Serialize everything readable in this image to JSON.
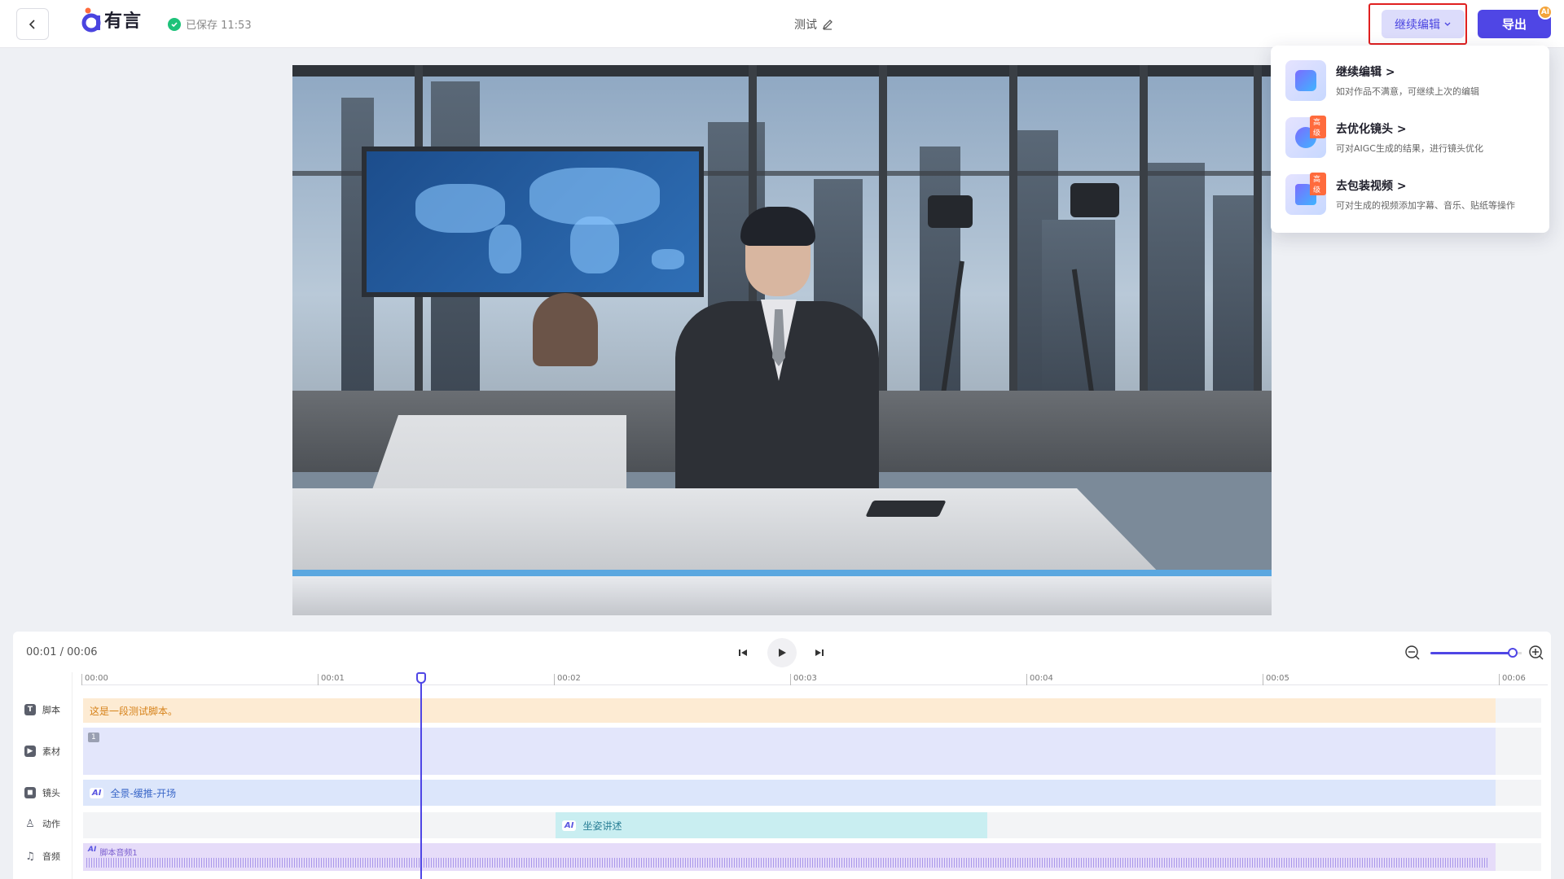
{
  "header": {
    "logo_text": "有言",
    "save_status": "已保存 11:53",
    "doc_title": "测试",
    "continue_label": "继续编辑",
    "export_label": "导出",
    "ai_badge": "AI"
  },
  "dropdown": {
    "items": [
      {
        "title": "继续编辑 >",
        "desc": "如对作品不满意，可继续上次的编辑",
        "tag": ""
      },
      {
        "title": "去优化镜头 >",
        "desc": "可对AIGC生成的结果，进行镜头优化",
        "tag": "高级"
      },
      {
        "title": "去包装视频 >",
        "desc": "可对生成的视频添加字幕、音乐、贴纸等操作",
        "tag": "高级"
      }
    ]
  },
  "timeline": {
    "current_time": "00:01 / 00:06",
    "zoom_level": 0.9,
    "ruler": [
      "00:00",
      "00:01",
      "00:02",
      "00:03",
      "00:04",
      "00:05",
      "00:06"
    ],
    "tracks": {
      "script": {
        "label": "脚本",
        "clip_text": "这是一段测试脚本。"
      },
      "material": {
        "label": "素材",
        "clip_index": "1"
      },
      "camera": {
        "label": "镜头",
        "clip_text": "全景-缓推-开场",
        "ai": "AI"
      },
      "action": {
        "label": "动作",
        "clip_text": "坐姿讲述",
        "ai": "AI"
      },
      "audio": {
        "label": "音频",
        "clip_text": "脚本音频1",
        "ai": "AI"
      }
    }
  },
  "colors": {
    "accent": "#4f46e5",
    "script_clip": "#fdebd3",
    "material_clip": "#e3e6fb",
    "camera_clip": "#dce6fb",
    "action_clip": "#c9eef1",
    "audio_clip": "#e6dcf9",
    "highlight": "#e02020"
  }
}
